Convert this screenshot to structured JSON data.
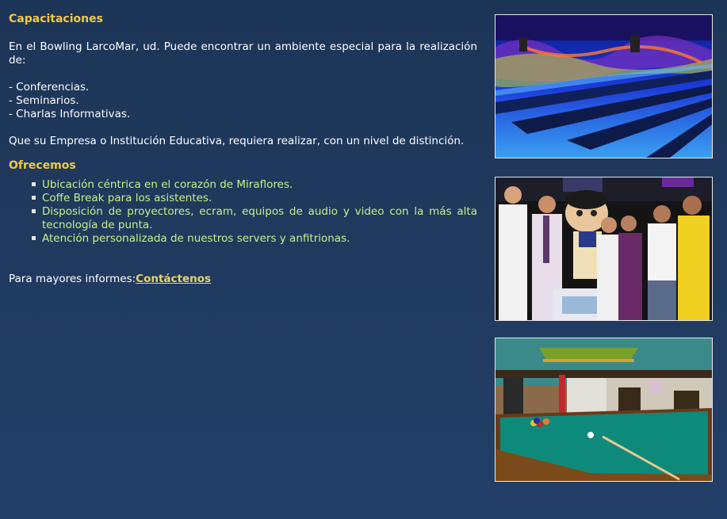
{
  "training": {
    "title": "Capacitaciones",
    "intro": "En el Bowling LarcoMar, ud. Puede encontrar un ambiente especial para la realización de:",
    "events": [
      "- Conferencias.",
      "- Seminarios.",
      "- Charlas Informativas."
    ],
    "closing": "Que su Empresa o Institución Educativa, requiera realizar, con un nivel de distinción."
  },
  "offer": {
    "title": "Ofrecemos",
    "items": [
      "Ubicación céntrica en el corazón de Miraflores.",
      "Coffe Break para los asistentes.",
      "Disposición de proyectores, ecram, equipos de audio y video con la más alta tecnología de punta.",
      "Atención personalizada de nuestros servers y anfitrionas."
    ]
  },
  "contact": {
    "prefix": "Para mayores informes:",
    "link": "Contáctenos"
  },
  "colors": {
    "heading": "#f4c842",
    "list_text": "#c9f08a",
    "link": "#e8d46e",
    "background": "#233f68"
  },
  "photos": [
    "bowling-lanes-photo",
    "group-with-mascot-photo",
    "billiard-table-photo"
  ]
}
